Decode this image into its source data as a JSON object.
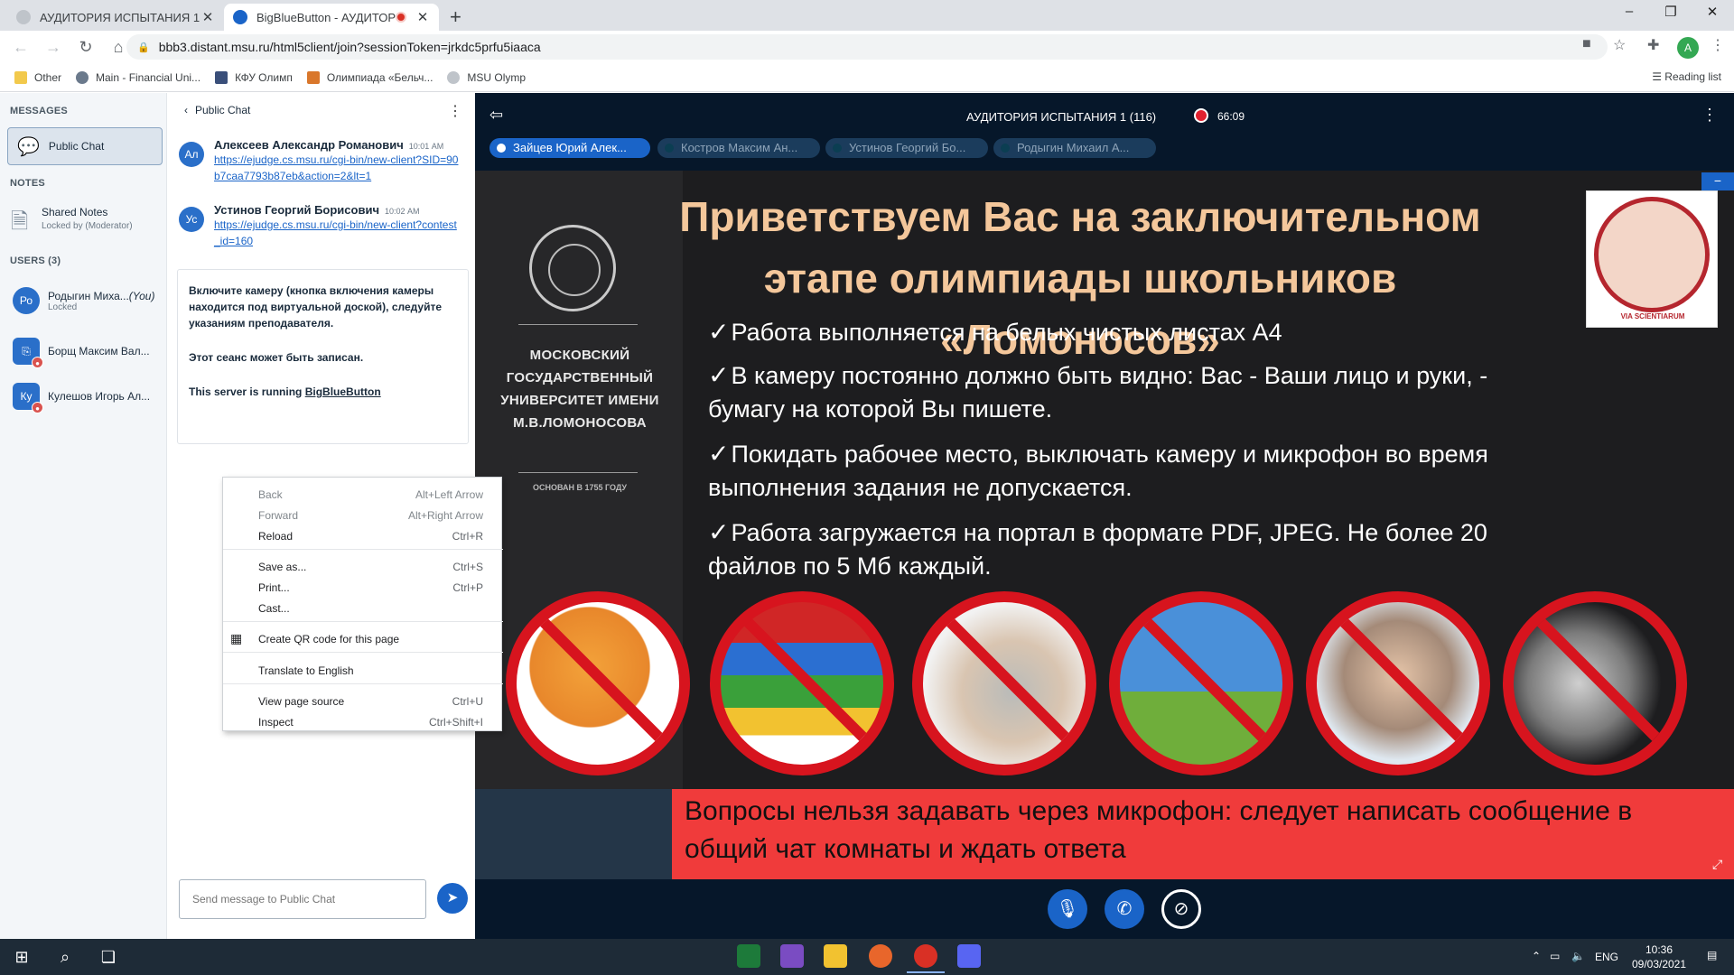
{
  "browser": {
    "tabs": [
      {
        "title": "АУДИТОРИЯ ИСПЫТАНИЯ 1",
        "active": false
      },
      {
        "title": "BigBlueButton - АУДИТОРИ",
        "active": true,
        "recording": true
      }
    ],
    "url": "bbb3.distant.msu.ru/html5client/join?sessionToken=jrkdc5prfu5iaaca",
    "bookmarks": [
      "Other",
      "Main - Financial Uni...",
      "КФУ Олимп",
      "Олимпиада «Бельч...",
      "MSU Olymp"
    ],
    "reading_list": "Reading list",
    "profile_initial": "A"
  },
  "sidebar": {
    "messages_header": "MESSAGES",
    "public_chat": "Public Chat",
    "notes_header": "NOTES",
    "shared_notes": "Shared Notes",
    "shared_notes_sub": "Locked by (Moderator)",
    "users_header": "USERS (3)",
    "users": [
      {
        "initials": "Ро",
        "name": "Родыгин Миха...",
        "you": "(You)",
        "sub": "Locked",
        "color": "#2a6fc9"
      },
      {
        "initials": "",
        "name": "Борщ Максим Вал...",
        "sub": "",
        "color": "#2a6fc9"
      },
      {
        "initials": "Ку",
        "name": "Кулешов Игорь Ал...",
        "sub": "",
        "color": "#2a6fc9"
      }
    ]
  },
  "chat": {
    "header": "Public Chat",
    "messages": [
      {
        "initials": "Ал",
        "name": "Алексеев Александр Романович",
        "time": "10:01 AM",
        "link": "https://ejudge.cs.msu.ru/cgi-bin/new-client?SID=90b7caa7793b87eb&action=2&lt=1"
      },
      {
        "initials": "Ус",
        "name": "Устинов Георгий Борисович",
        "time": "10:02 AM",
        "link": "https://ejudge.cs.msu.ru/cgi-bin/new-client?contest_id=160"
      }
    ],
    "system_lines": [
      "Включите камеру (кнопка включения камеры находится под виртуальной доской), следуйте указаниям преподавателя.",
      "Этот сеанс может быть записан."
    ],
    "server_prefix": "This server is running ",
    "server_link": "BigBlueButton",
    "input_placeholder": "Send message to Public Chat"
  },
  "context_menu": [
    {
      "label": "Back",
      "shortcut": "Alt+Left Arrow",
      "disabled": true
    },
    {
      "label": "Forward",
      "shortcut": "Alt+Right Arrow",
      "disabled": true
    },
    {
      "label": "Reload",
      "shortcut": "Ctrl+R"
    },
    {
      "label": "Save as...",
      "shortcut": "Ctrl+S"
    },
    {
      "label": "Print...",
      "shortcut": "Ctrl+P"
    },
    {
      "label": "Cast...",
      "shortcut": ""
    },
    {
      "label": "Create QR code for this page",
      "shortcut": ""
    },
    {
      "label": "Translate to English",
      "shortcut": ""
    },
    {
      "label": "View page source",
      "shortcut": "Ctrl+U"
    },
    {
      "label": "Inspect",
      "shortcut": "Ctrl+Shift+I"
    }
  ],
  "presentation": {
    "meeting_title": "АУДИТОРИЯ ИСПЫТАНИЯ 1 (116)",
    "recording_time": "66:09",
    "talkers": [
      "Зайцев Юрий Алек...",
      "Костров Максим Ан...",
      "Устинов Георгий Бо...",
      "Родыгин Михаил А..."
    ],
    "slide": {
      "university_name": "МОСКОВСКИЙ ГОСУДАРСТВЕННЫЙ УНИВЕРСИТЕТ ИМЕНИ М.В.ЛОМОНОСОВА",
      "founded": "ОСНОВАН В 1755 ГОДУ",
      "title": "Приветствуем Вас на заключительном этапе олимпиады школьников «Ломоносов»",
      "logo_motto": "VIA SCIENTIARUM",
      "check_mark": "✓",
      "rules": [
        "Работа выполняется на белых чистых листах А4",
        "В камеру постоянно должно быть видно: Вас - Ваши лицо и руки, - бумагу на которой Вы пишете.",
        "Покидать рабочее место, выключать камеру и микрофон во время выполнения задания не допускается.",
        "Работа загружается на портал в формате PDF, JPEG. Не более 20 файлов по 5 Мб каждый."
      ],
      "banner": "Вопросы нельзя задавать через микрофон: следует написать сообщение в общий чат комнаты и ждать ответа"
    }
  },
  "taskbar": {
    "lang": "ENG",
    "time": "10:36",
    "date": "09/03/2021"
  },
  "colors": {
    "accent": "#1a64c8",
    "slide_bg": "#1d1d1f",
    "title": "#f4c79b",
    "ban_red": "#d7141e",
    "banner_red": "#f03b3b"
  }
}
